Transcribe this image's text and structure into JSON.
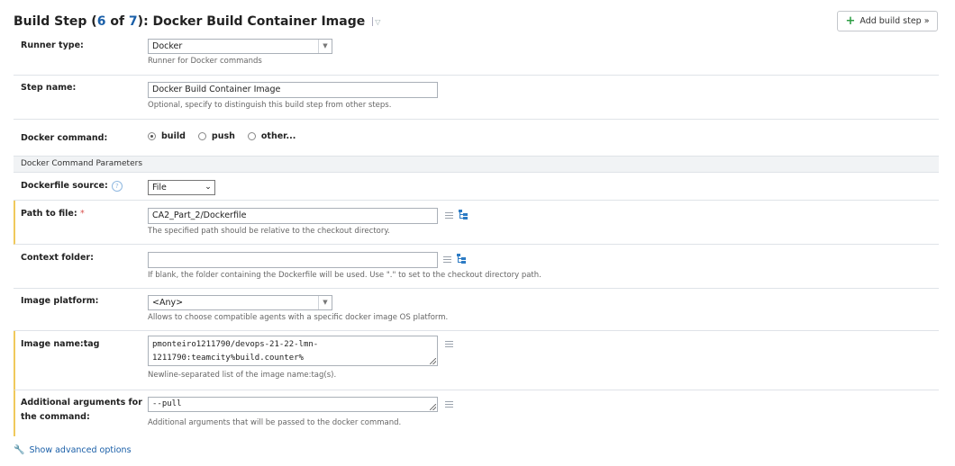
{
  "header": {
    "title_prefix": "Build Step (",
    "step_current": "6",
    "title_of": " of ",
    "step_total": "7",
    "title_suffix": "): Docker Build Container Image",
    "add_button_label": "Add build step »"
  },
  "form": {
    "runner_type": {
      "label": "Runner type:",
      "value": "Docker",
      "note": "Runner for Docker commands"
    },
    "step_name": {
      "label": "Step name:",
      "value": "Docker Build Container Image",
      "note": "Optional, specify to distinguish this build step from other steps."
    },
    "docker_command": {
      "label": "Docker command:",
      "options": [
        "build",
        "push",
        "other..."
      ],
      "selected": "build"
    },
    "section_title": "Docker Command Parameters",
    "dockerfile_source": {
      "label": "Dockerfile source:",
      "help_glyph": "?",
      "value": "File"
    },
    "path_to_file": {
      "label": "Path to file:",
      "required_mark": "*",
      "value": "CA2_Part_2/Dockerfile",
      "note": "The specified path should be relative to the checkout directory."
    },
    "context_folder": {
      "label": "Context folder:",
      "value": "",
      "note": "If blank, the folder containing the Dockerfile will be used. Use \".\" to set to the checkout directory path."
    },
    "image_platform": {
      "label": "Image platform:",
      "value": "<Any>",
      "note": "Allows to choose compatible agents with a specific docker image OS platform."
    },
    "image_name_tag": {
      "label": "Image name:tag",
      "line1": "pmonteiro1211790/devops-21-22-lmn-",
      "line2": "1211790:teamcity%build.counter%",
      "note": "Newline-separated list of the image name:tag(s)."
    },
    "additional_args": {
      "label_line1": "Additional arguments for",
      "label_line2": "the command:",
      "value": "--pull",
      "note": "Additional arguments that will be passed to the docker command."
    }
  },
  "footer": {
    "advanced_link": "Show advanced options"
  },
  "colors": {
    "accent_blue": "#1a5fa8",
    "required_bar": "#f0c95c",
    "plus_green": "#2e9e44"
  },
  "icons": [
    "chevron-down-icon",
    "plus-icon",
    "help-icon",
    "insert-param-icon",
    "tree-browse-icon",
    "wrench-icon",
    "resize-grip-icon"
  ]
}
